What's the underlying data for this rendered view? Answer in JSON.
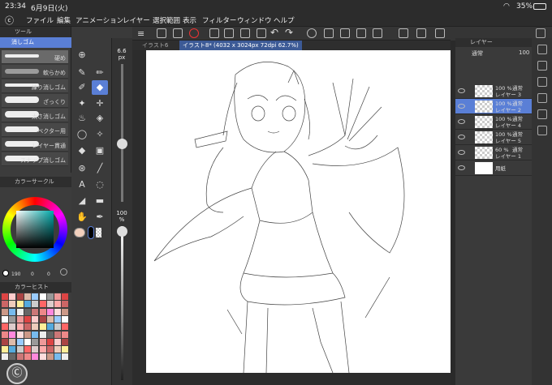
{
  "status": {
    "time": "23:34",
    "date": "6月9日(火)",
    "battery": "35%"
  },
  "menu": [
    "ファイル",
    "編集",
    "アニメーション",
    "レイヤー",
    "選択範囲",
    "表示",
    "フィルター",
    "ウィンドウ",
    "ヘルプ"
  ],
  "subtool": {
    "header": "ツール",
    "group": "消しゴム",
    "brushes": [
      "硬め",
      "軟らかめ",
      "練り消しゴム",
      "ざっくり",
      "太さ消しゴム",
      "ベクター用",
      "レイヤー貫通",
      "スナップ消しゴム"
    ]
  },
  "color": {
    "header": "カラーサークル",
    "readout": [
      "190",
      "0",
      "0"
    ]
  },
  "history": {
    "header": "カラーヒスト"
  },
  "sliders": {
    "size": "6.6",
    "unit": "px",
    "opacity": "100",
    "opacity_unit": "%"
  },
  "canvas": {
    "tab1": "イラスト6",
    "tab2": "イラスト8* (4032 x 3024px 72dpi 62.7%)"
  },
  "layers": {
    "header": "レイヤー",
    "blend": "通常",
    "opacity": "100",
    "rows": [
      {
        "pct": "100 %",
        "mode": "通常",
        "name": "レイヤー 3"
      },
      {
        "pct": "100 %",
        "mode": "通常",
        "name": "レイヤー 2"
      },
      {
        "pct": "100 %",
        "mode": "通常",
        "name": "レイヤー 4"
      },
      {
        "pct": "100 %",
        "mode": "通常",
        "name": "レイヤー 5"
      },
      {
        "pct": "60 %",
        "mode": "通常",
        "name": "レイヤー 1"
      },
      {
        "pct": "",
        "mode": "",
        "name": "用紙"
      }
    ]
  },
  "colors": {
    "accent": "#5a7fd6",
    "bg": "#3a3a3a",
    "canvas": "#ffffff"
  }
}
